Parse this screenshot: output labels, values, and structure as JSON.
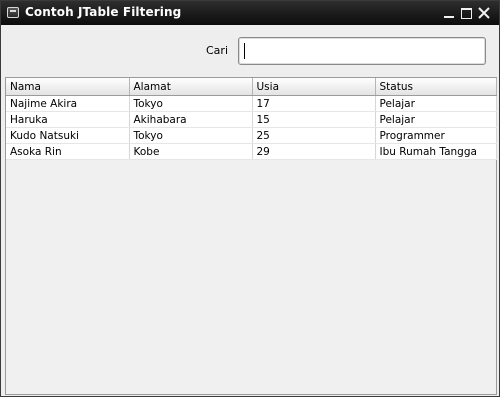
{
  "window": {
    "title": "Contoh JTable Filtering",
    "icons": {
      "app": "java-window-icon",
      "minimize": "minimize-icon",
      "maximize": "maximize-icon",
      "close": "close-icon"
    }
  },
  "search": {
    "label": "Cari",
    "value": ""
  },
  "table": {
    "columns": [
      "Nama",
      "Alamat",
      "Usia",
      "Status"
    ],
    "rows": [
      [
        "Najime Akira",
        "Tokyo",
        "17",
        "Pelajar"
      ],
      [
        "Haruka",
        "Akihabara",
        "15",
        "Pelajar"
      ],
      [
        "Kudo Natsuki",
        "Tokyo",
        "25",
        "Programmer"
      ],
      [
        "Asoka Rin",
        "Kobe",
        "29",
        "Ibu Rumah Tangga"
      ]
    ]
  }
}
